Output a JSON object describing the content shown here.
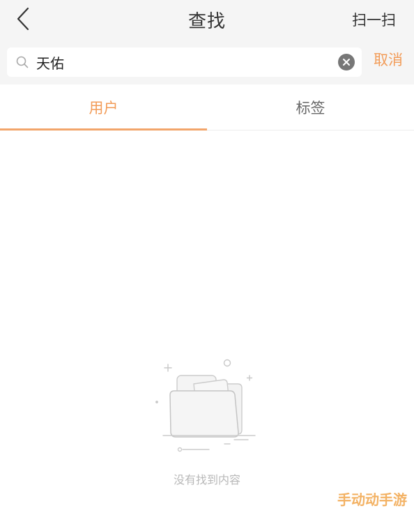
{
  "header": {
    "title": "查找",
    "scan_label": "扫一扫"
  },
  "search": {
    "value": "天佑",
    "cancel_label": "取消"
  },
  "tabs": [
    {
      "label": "用户",
      "active": true
    },
    {
      "label": "标签",
      "active": false
    }
  ],
  "empty_state": {
    "message": "没有找到内容"
  },
  "watermark": {
    "text": "手动动手游"
  },
  "colors": {
    "accent": "#f29b57",
    "header_bg": "#f5f5f5",
    "text_primary": "#333333",
    "text_muted": "#b8b8b8"
  }
}
